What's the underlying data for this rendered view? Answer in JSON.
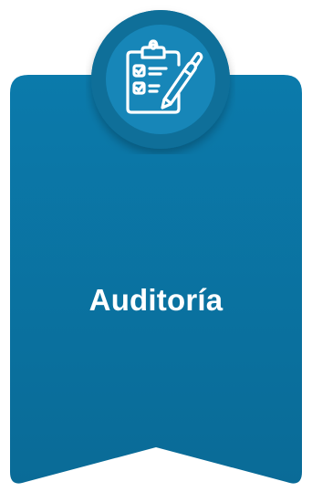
{
  "card": {
    "title": "Auditoría",
    "icon": "clipboard-checklist-pen-icon"
  },
  "colors": {
    "banner": "#0A6E9B",
    "banner_top": "#0B7AAB",
    "badge_outer": "#0F6D96",
    "badge_inner": "#1584B5",
    "icon_stroke": "#FFFFFF",
    "title": "#FFFFFF"
  }
}
